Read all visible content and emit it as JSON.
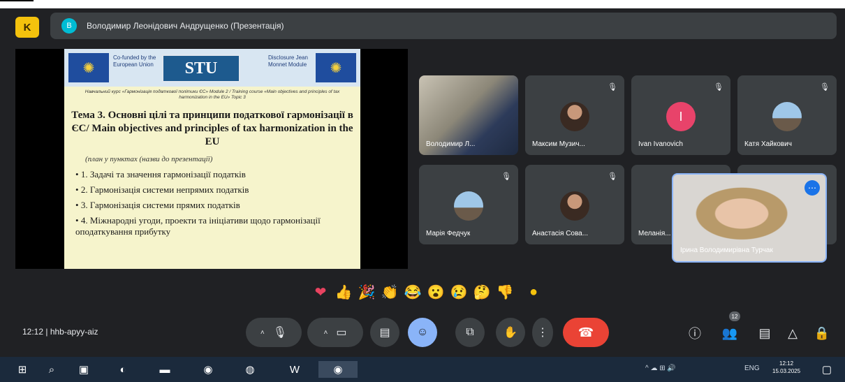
{
  "app": {
    "logo_letter": "K",
    "presenter_bar": {
      "avatar_letter": "В",
      "text": "Володимир Леонідович Андрущенко (Презентація)"
    }
  },
  "slide": {
    "header": {
      "left_text": "Co-funded by the European Union",
      "center_logo": "STU",
      "right_text": "Disclosure Jean Monnet Module"
    },
    "course_info": "Навчальний курс «Гармонізація податкової політики ЄС» Module 2 / Training course «Main objectives and principles of tax harmonization in the EU» Topic 3",
    "title": "Тема 3. Основні цілі та принципи податкової гармонізації в ЄС/ Main objectives and principles of tax harmonization in the EU",
    "subtitle": "(план у пунктах (назви до презентації)",
    "bullets": [
      "1. Задачі та значення гармонізації податків",
      "2. Гармонізація системи непрямих податків",
      "3. Гармонізація системи прямих податків",
      "4. Міжнародні угоди, проекти та ініціативи щодо гармонізації оподаткування прибутку"
    ]
  },
  "participants": [
    {
      "name": "Володимир Л...",
      "type": "video"
    },
    {
      "name": "Максим Музич...",
      "type": "photo"
    },
    {
      "name": "Ivan Ivanovich",
      "type": "initial",
      "initial": "I"
    },
    {
      "name": "Катя Хайкович",
      "type": "sky"
    },
    {
      "name": "Марія Федчук",
      "type": "sky"
    },
    {
      "name": "Анастасія Сова...",
      "type": "photo"
    },
    {
      "name": "Меланія...",
      "type": "photo"
    },
    {
      "name": "Ірина Володимирівна Турчак",
      "type": "video"
    }
  ],
  "icons": {
    "mic": "mic-icon",
    "camera": "camera-icon",
    "captions": "captions-icon",
    "emoji": "emoji-icon",
    "present": "present-icon",
    "raise_hand": "hand-icon",
    "more": "more-icon",
    "end_call": "end-call-icon",
    "info": "info-icon",
    "people": "people-icon",
    "chat": "chat-icon",
    "activities": "activities-icon",
    "lock": "lock-icon"
  },
  "reactions": [
    "❤",
    "👍",
    "🎉",
    "👏",
    "😂",
    "😮",
    "😢",
    "🤔",
    "👎",
    "●"
  ],
  "meeting": {
    "time": "12:12",
    "code": "hhb-apyy-aiz",
    "people_count": "12"
  },
  "taskbar": {
    "tray_text": "^ ☁ ⊞ 🔊",
    "lang": "ENG",
    "clock_time": "12:12",
    "clock_date": "15.03.2025"
  },
  "colors": {
    "accent": "#8ab4f8",
    "end_call": "#ea4335",
    "logo": "#f4c20d"
  }
}
